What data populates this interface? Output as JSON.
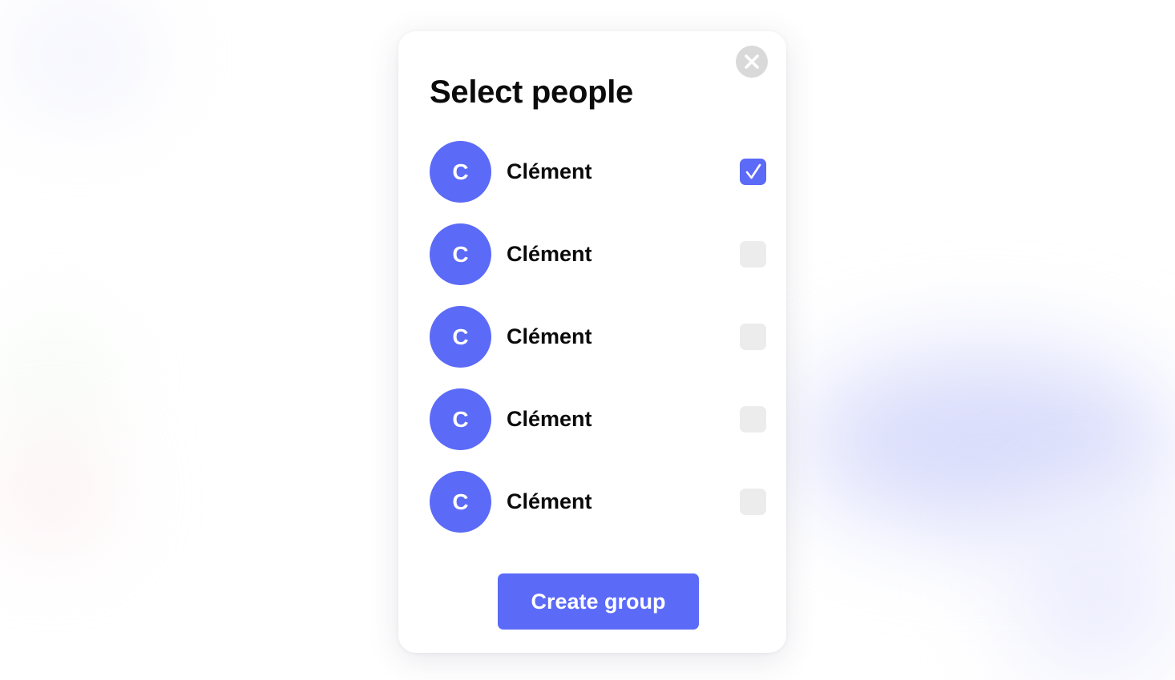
{
  "modal": {
    "title": "Select people",
    "close_icon": "close-icon",
    "people": [
      {
        "initial": "C",
        "name": "Clément",
        "selected": true
      },
      {
        "initial": "C",
        "name": "Clément",
        "selected": false
      },
      {
        "initial": "C",
        "name": "Clément",
        "selected": false
      },
      {
        "initial": "C",
        "name": "Clément",
        "selected": false
      },
      {
        "initial": "C",
        "name": "Clément",
        "selected": false
      }
    ],
    "create_label": "Create group"
  },
  "colors": {
    "accent": "#5b6af7",
    "checkbox_unchecked": "#ececec",
    "close_button": "#d9d9d9",
    "text": "#0b0b0b"
  }
}
